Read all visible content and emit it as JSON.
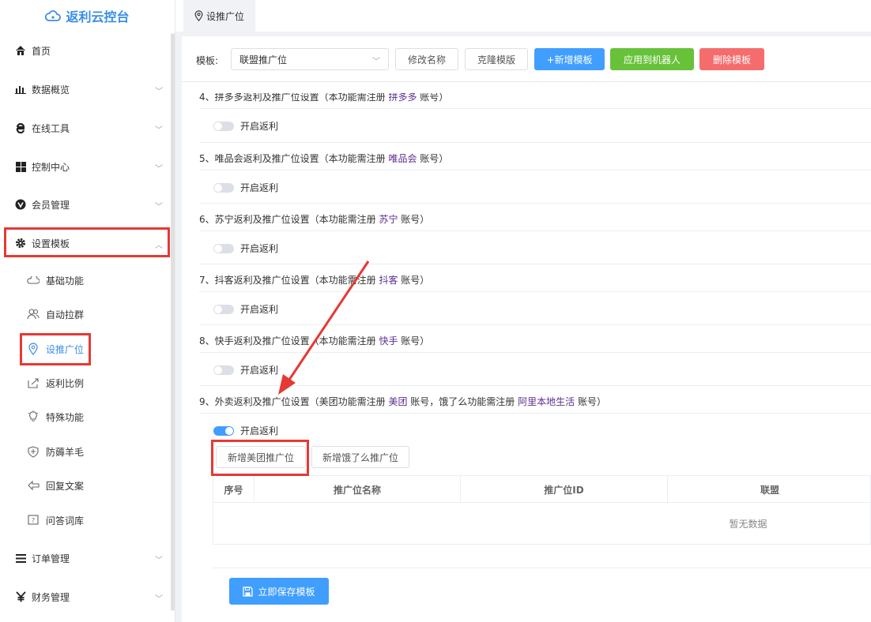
{
  "app": {
    "title": "返利云控台"
  },
  "tab": {
    "label": "设推广位"
  },
  "sidebar": {
    "menus": [
      {
        "label": "首页"
      },
      {
        "label": "数据概览"
      },
      {
        "label": "在线工具"
      },
      {
        "label": "控制中心"
      },
      {
        "label": "会员管理"
      },
      {
        "label": "设置模板"
      },
      {
        "label": "订单管理"
      },
      {
        "label": "财务管理"
      }
    ],
    "sub": [
      {
        "label": "基础功能"
      },
      {
        "label": "自动拉群"
      },
      {
        "label": "设推广位"
      },
      {
        "label": "返利比例"
      },
      {
        "label": "特殊功能"
      },
      {
        "label": "防薅羊毛"
      },
      {
        "label": "回复文案"
      },
      {
        "label": "问答词库"
      }
    ]
  },
  "toolbar": {
    "label": "模板:",
    "select_value": "联盟推广位",
    "rename": "修改名称",
    "clone": "克隆模版",
    "add": "+新增模板",
    "apply": "应用到机器人",
    "delete": "删除模板"
  },
  "sections": [
    {
      "prefix": "4、拼多多返利及推广位设置（本功能需注册 ",
      "hl": "拼多多",
      "suffix": " 账号）"
    },
    {
      "prefix": "5、唯品会返利及推广位设置（本功能需注册 ",
      "hl": "唯品会",
      "suffix": " 账号）"
    },
    {
      "prefix": "6、苏宁返利及推广位设置（本功能需注册 ",
      "hl": "苏宁",
      "suffix": " 账号）"
    },
    {
      "prefix": "7、抖客返利及推广位设置（本功能需注册 ",
      "hl": "抖客",
      "suffix": " 账号）"
    },
    {
      "prefix": "8、快手返利及推广位设置（本功能需注册 ",
      "hl": "快手",
      "suffix": " 账号）"
    },
    {
      "prefix": "9、外卖返利及推广位设置（美团功能需注册 ",
      "hl": "美团",
      "mid": " 账号，饿了么功能需注册 ",
      "hl2": "阿里本地生活",
      "suffix": " 账号）"
    }
  ],
  "toggle_label": "开启返利",
  "buttons": {
    "add_meituan": "新增美团推广位",
    "add_eleme": "新增饿了么推广位"
  },
  "table": {
    "headers": [
      "序号",
      "推广位名称",
      "推广位ID",
      "联盟"
    ],
    "empty": "暂无数据"
  },
  "save": "立即保存模板",
  "colors": {
    "accent": "#409eff",
    "green": "#67c23a",
    "danger": "#f56c6c",
    "annotation": "#e53935"
  }
}
